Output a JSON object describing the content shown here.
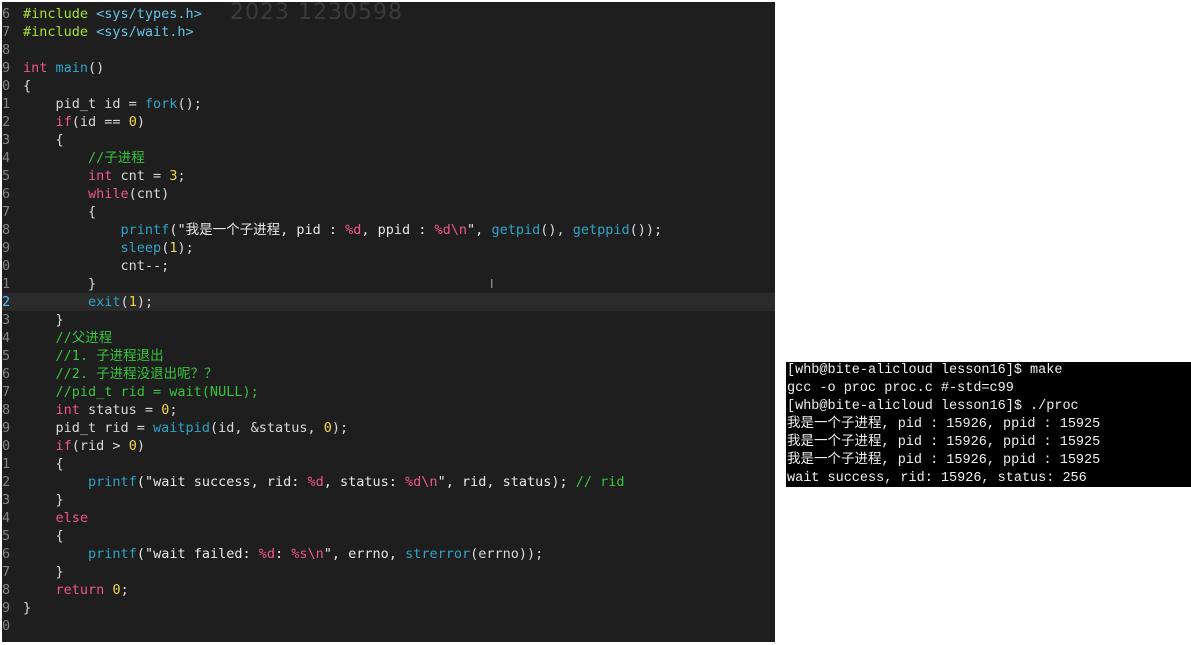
{
  "watermark": "2023 1230598",
  "editor": {
    "current_line": "2",
    "lines": [
      {
        "n": "6",
        "tokens": [
          {
            "t": "#include ",
            "c": "pre"
          },
          {
            "t": "<sys/types.h>",
            "c": "inc"
          }
        ]
      },
      {
        "n": "7",
        "tokens": [
          {
            "t": "#include ",
            "c": "pre"
          },
          {
            "t": "<sys/wait.h>",
            "c": "inc"
          }
        ]
      },
      {
        "n": "8",
        "tokens": []
      },
      {
        "n": "9",
        "tokens": [
          {
            "t": "int ",
            "c": "kw"
          },
          {
            "t": "main",
            "c": "fn"
          },
          {
            "t": "()",
            "c": "plain"
          }
        ]
      },
      {
        "n": "0",
        "tokens": [
          {
            "t": "{",
            "c": "plain"
          }
        ]
      },
      {
        "n": "1",
        "tokens": [
          {
            "t": "    pid_t id = ",
            "c": "plain"
          },
          {
            "t": "fork",
            "c": "fn"
          },
          {
            "t": "();",
            "c": "plain"
          }
        ]
      },
      {
        "n": "2",
        "tokens": [
          {
            "t": "    ",
            "c": "plain"
          },
          {
            "t": "if",
            "c": "kw"
          },
          {
            "t": "(id == ",
            "c": "plain"
          },
          {
            "t": "0",
            "c": "num"
          },
          {
            "t": ")",
            "c": "plain"
          }
        ]
      },
      {
        "n": "3",
        "tokens": [
          {
            "t": "    {",
            "c": "plain"
          }
        ]
      },
      {
        "n": "4",
        "tokens": [
          {
            "t": "        //子进程",
            "c": "cmt"
          }
        ]
      },
      {
        "n": "5",
        "tokens": [
          {
            "t": "        ",
            "c": "plain"
          },
          {
            "t": "int",
            "c": "kw"
          },
          {
            "t": " cnt = ",
            "c": "plain"
          },
          {
            "t": "3",
            "c": "num"
          },
          {
            "t": ";",
            "c": "plain"
          }
        ]
      },
      {
        "n": "6",
        "tokens": [
          {
            "t": "        ",
            "c": "plain"
          },
          {
            "t": "while",
            "c": "kw"
          },
          {
            "t": "(cnt)",
            "c": "plain"
          }
        ]
      },
      {
        "n": "7",
        "tokens": [
          {
            "t": "        {",
            "c": "plain"
          }
        ]
      },
      {
        "n": "8",
        "tokens": [
          {
            "t": "            ",
            "c": "plain"
          },
          {
            "t": "printf",
            "c": "fn"
          },
          {
            "t": "(\"我是一个子进程, pid : ",
            "c": "str"
          },
          {
            "t": "%d",
            "c": "fmt"
          },
          {
            "t": ", ppid : ",
            "c": "str"
          },
          {
            "t": "%d\\n",
            "c": "fmt"
          },
          {
            "t": "\", ",
            "c": "str"
          },
          {
            "t": "getpid",
            "c": "fn"
          },
          {
            "t": "(), ",
            "c": "plain"
          },
          {
            "t": "getppid",
            "c": "fn"
          },
          {
            "t": "());",
            "c": "plain"
          }
        ]
      },
      {
        "n": "9",
        "tokens": [
          {
            "t": "            ",
            "c": "plain"
          },
          {
            "t": "sleep",
            "c": "fn"
          },
          {
            "t": "(",
            "c": "plain"
          },
          {
            "t": "1",
            "c": "num"
          },
          {
            "t": ");",
            "c": "plain"
          }
        ]
      },
      {
        "n": "0",
        "tokens": [
          {
            "t": "            cnt--;",
            "c": "plain"
          }
        ]
      },
      {
        "n": "1",
        "tokens": [
          {
            "t": "        }",
            "c": "plain"
          }
        ]
      },
      {
        "n": "2",
        "tokens": [
          {
            "t": "        ",
            "c": "plain"
          },
          {
            "t": "exit",
            "c": "fn"
          },
          {
            "t": "(",
            "c": "plain"
          },
          {
            "t": "1",
            "c": "num"
          },
          {
            "t": ");",
            "c": "plain"
          }
        ],
        "current": true
      },
      {
        "n": "3",
        "tokens": [
          {
            "t": "    }",
            "c": "plain"
          }
        ]
      },
      {
        "n": "4",
        "tokens": [
          {
            "t": "    //父进程",
            "c": "cmt"
          }
        ]
      },
      {
        "n": "5",
        "tokens": [
          {
            "t": "    //1. 子进程退出",
            "c": "cmt"
          }
        ]
      },
      {
        "n": "6",
        "tokens": [
          {
            "t": "    //2. 子进程没退出呢？？",
            "c": "cmt"
          }
        ]
      },
      {
        "n": "7",
        "tokens": [
          {
            "t": "    //pid_t rid = wait(NULL);",
            "c": "cmt"
          }
        ]
      },
      {
        "n": "8",
        "tokens": [
          {
            "t": "    ",
            "c": "plain"
          },
          {
            "t": "int",
            "c": "kw"
          },
          {
            "t": " status = ",
            "c": "plain"
          },
          {
            "t": "0",
            "c": "num"
          },
          {
            "t": ";",
            "c": "plain"
          }
        ]
      },
      {
        "n": "9",
        "tokens": [
          {
            "t": "    pid_t rid = ",
            "c": "plain"
          },
          {
            "t": "waitpid",
            "c": "fn"
          },
          {
            "t": "(id, &status, ",
            "c": "plain"
          },
          {
            "t": "0",
            "c": "num"
          },
          {
            "t": ");",
            "c": "plain"
          }
        ]
      },
      {
        "n": "0",
        "tokens": [
          {
            "t": "    ",
            "c": "plain"
          },
          {
            "t": "if",
            "c": "kw"
          },
          {
            "t": "(rid > ",
            "c": "plain"
          },
          {
            "t": "0",
            "c": "num"
          },
          {
            "t": ")",
            "c": "plain"
          }
        ]
      },
      {
        "n": "1",
        "tokens": [
          {
            "t": "    {",
            "c": "plain"
          }
        ]
      },
      {
        "n": "2",
        "tokens": [
          {
            "t": "        ",
            "c": "plain"
          },
          {
            "t": "printf",
            "c": "fn"
          },
          {
            "t": "(\"wait success, rid: ",
            "c": "str"
          },
          {
            "t": "%d",
            "c": "fmt"
          },
          {
            "t": ", status: ",
            "c": "str"
          },
          {
            "t": "%d\\n",
            "c": "fmt"
          },
          {
            "t": "\", rid, status); ",
            "c": "str"
          },
          {
            "t": "// rid",
            "c": "cmt"
          }
        ]
      },
      {
        "n": "3",
        "tokens": [
          {
            "t": "    }",
            "c": "plain"
          }
        ]
      },
      {
        "n": "4",
        "tokens": [
          {
            "t": "    ",
            "c": "plain"
          },
          {
            "t": "else",
            "c": "kw"
          }
        ]
      },
      {
        "n": "5",
        "tokens": [
          {
            "t": "    {",
            "c": "plain"
          }
        ]
      },
      {
        "n": "6",
        "tokens": [
          {
            "t": "        ",
            "c": "plain"
          },
          {
            "t": "printf",
            "c": "fn"
          },
          {
            "t": "(\"wait failed: ",
            "c": "str"
          },
          {
            "t": "%d",
            "c": "fmt"
          },
          {
            "t": ": ",
            "c": "str"
          },
          {
            "t": "%s\\n",
            "c": "fmt"
          },
          {
            "t": "\", errno, ",
            "c": "str"
          },
          {
            "t": "strerror",
            "c": "fn"
          },
          {
            "t": "(errno));",
            "c": "plain"
          }
        ]
      },
      {
        "n": "7",
        "tokens": [
          {
            "t": "    }",
            "c": "plain"
          }
        ]
      },
      {
        "n": "8",
        "tokens": [
          {
            "t": "    ",
            "c": "plain"
          },
          {
            "t": "return",
            "c": "kw"
          },
          {
            "t": " ",
            "c": "plain"
          },
          {
            "t": "0",
            "c": "num"
          },
          {
            "t": ";",
            "c": "plain"
          }
        ]
      },
      {
        "n": "9",
        "tokens": [
          {
            "t": "}",
            "c": "plain"
          }
        ]
      },
      {
        "n": "0",
        "tokens": []
      }
    ]
  },
  "terminal": {
    "lines": [
      "[whb@bite-alicloud lesson16]$ make",
      "gcc -o proc proc.c #-std=c99",
      "[whb@bite-alicloud lesson16]$ ./proc",
      "我是一个子进程, pid : 15926, ppid : 15925",
      "我是一个子进程, pid : 15926, ppid : 15925",
      "我是一个子进程, pid : 15926, ppid : 15925",
      "wait success, rid: 15926, status: 256"
    ]
  },
  "colors": {
    "editor_bg": "#1e1e1e",
    "terminal_bg": "#000000",
    "keyword": "#f0568c",
    "function": "#2ea3c8",
    "comment": "#36c43d",
    "number": "#f4d64a",
    "preprocessor": "#a6e22e"
  },
  "icons": {
    "text_cursor": "i-beam-cursor-icon"
  }
}
